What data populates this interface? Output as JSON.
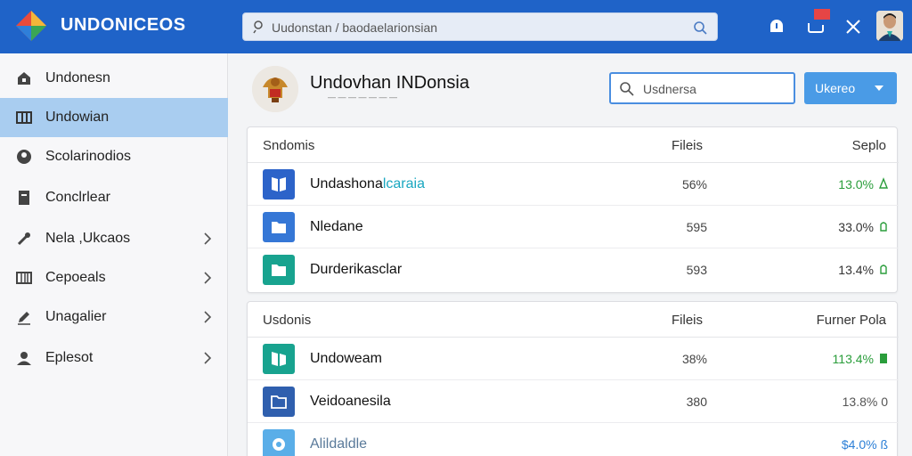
{
  "header": {
    "app_title": "UNDONICEOS",
    "search_placeholder": "Uudonstan / baodaelarionsian",
    "colors": {
      "bar": "#1f63c8"
    },
    "icons": [
      "app-logo-icon",
      "search-icon",
      "search-submit-icon",
      "alert-icon",
      "notifications-icon",
      "close-icon"
    ]
  },
  "sidebar": {
    "items": [
      {
        "label": "Undonesn",
        "icon": "home-icon",
        "active": false,
        "chevron": false
      },
      {
        "label": "Undowian",
        "icon": "grid-icon",
        "active": true,
        "chevron": false
      },
      {
        "label": "Scolarinodios",
        "icon": "user-circle-icon",
        "active": false,
        "chevron": false
      },
      {
        "label": "Conclrlear",
        "icon": "document-icon",
        "active": false,
        "chevron": false
      },
      {
        "label": "Nela ,Ukcaos",
        "icon": "tools-icon",
        "active": false,
        "chevron": true
      },
      {
        "label": "Cepoeals",
        "icon": "columns-icon",
        "active": false,
        "chevron": true
      },
      {
        "label": "Unagalier",
        "icon": "edit-icon",
        "active": false,
        "chevron": true
      },
      {
        "label": "Eplesot",
        "icon": "users-icon",
        "active": false,
        "chevron": true
      }
    ]
  },
  "main": {
    "org_title": "Undovhan INDonsia",
    "org_subtitle": "— — — — — — —",
    "search_placeholder": "Usdnersa",
    "action_button": "Ukereo"
  },
  "table1": {
    "headers": [
      "Sndomis",
      "Fileis",
      "Seplo"
    ],
    "rows": [
      {
        "name": "Undashona",
        "name_hl": "lcaraia",
        "value": "56%",
        "pct": "13.0%",
        "color": "#2a9d3b",
        "icon_color": "#2c63c9"
      },
      {
        "name": "Nledane",
        "name_hl": "",
        "value": "595",
        "pct": "33.0%",
        "color": "#333333",
        "icon_color": "#3577d6"
      },
      {
        "name": "Durderikasclar",
        "name_hl": "",
        "value": "593",
        "pct": "13.4%",
        "color": "#333333",
        "icon_color": "#18a38f"
      }
    ]
  },
  "table2": {
    "headers": [
      "Usdonis",
      "Fileis",
      "Furner Pola"
    ],
    "rows": [
      {
        "name": "Undoweam",
        "name_hl": "",
        "value": "38%",
        "pct": "113.4%",
        "color": "#2a9d3b",
        "icon_color": "#18a38f"
      },
      {
        "name": "Veidoanesila",
        "name_hl": "",
        "value": "380",
        "pct": "13.8% 0",
        "color": "#555555",
        "icon_color": "#2f5fae"
      },
      {
        "name": "Alildaldle",
        "name_hl": "",
        "value": "",
        "pct": "$4.0% ß",
        "color": "#2c7fd6",
        "icon_color": "#5aaee8"
      }
    ]
  }
}
